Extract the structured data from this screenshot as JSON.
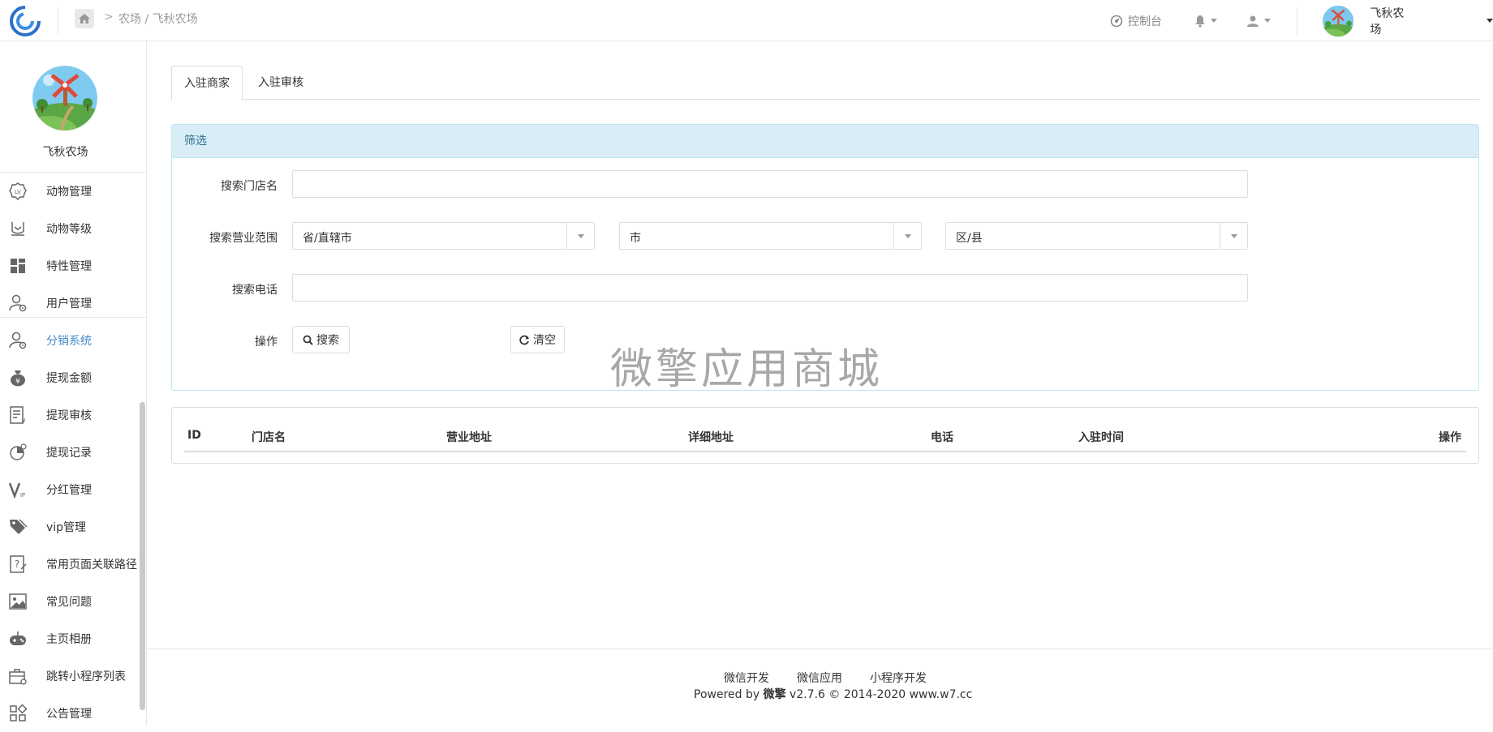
{
  "header": {
    "breadcrumb": "农场 / 飞秋农场",
    "breadcrumb_arrow": ">",
    "console_label": "控制台",
    "account_name": "飞秋农场"
  },
  "sidebar": {
    "farm_name": "飞秋农场",
    "items": [
      {
        "label": "动物管理",
        "icon": "lv-badge-icon"
      },
      {
        "label": "动物等级",
        "icon": "level-icon"
      },
      {
        "label": "特性管理",
        "icon": "grid-icon"
      },
      {
        "label": "用户管理",
        "icon": "user-gear-icon"
      },
      {
        "label": "分销系统",
        "icon": "user-gear-icon",
        "active": true
      },
      {
        "label": "提现金额",
        "icon": "money-bag-icon"
      },
      {
        "label": "提现审核",
        "icon": "receipt-icon"
      },
      {
        "label": "提现记录",
        "icon": "chart-clock-icon"
      },
      {
        "label": "分红管理",
        "icon": "vip-icon"
      },
      {
        "label": "vip管理",
        "icon": "tag-icon"
      },
      {
        "label": "常用页面关联路径",
        "icon": "question-doc-icon"
      },
      {
        "label": "常见问题",
        "icon": "image-icon"
      },
      {
        "label": "主页相册",
        "icon": "gamepad-icon"
      },
      {
        "label": "跳转小程序列表",
        "icon": "briefcase-gear-icon"
      },
      {
        "label": "公告管理",
        "icon": "apps-icon"
      }
    ]
  },
  "tabs": [
    {
      "label": "入驻商家",
      "active": true
    },
    {
      "label": "入驻审核",
      "active": false
    }
  ],
  "filter": {
    "title": "筛选",
    "store_label": "搜索门店名",
    "store_value": "",
    "scope_label": "搜索营业范围",
    "province": "省/直辖市",
    "city": "市",
    "district": "区/县",
    "phone_label": "搜索电话",
    "phone_value": "",
    "action_label": "操作",
    "search_button": "搜索",
    "clear_button": "清空"
  },
  "watermark": "微擎应用商城",
  "table": {
    "columns": [
      "ID",
      "门店名",
      "营业地址",
      "详细地址",
      "电话",
      "入驻时间",
      "操作"
    ],
    "rows": []
  },
  "footer": {
    "links": [
      "微信开发",
      "微信应用",
      "小程序开发"
    ],
    "copy_prefix": "Powered by ",
    "copy_brand": "微擎",
    "copy_suffix": " v2.7.6 © 2014-2020 www.w7.cc"
  },
  "colors": {
    "accent": "#428bca",
    "panel_head": "#d9edf7",
    "panel_border": "#bce8f1"
  }
}
